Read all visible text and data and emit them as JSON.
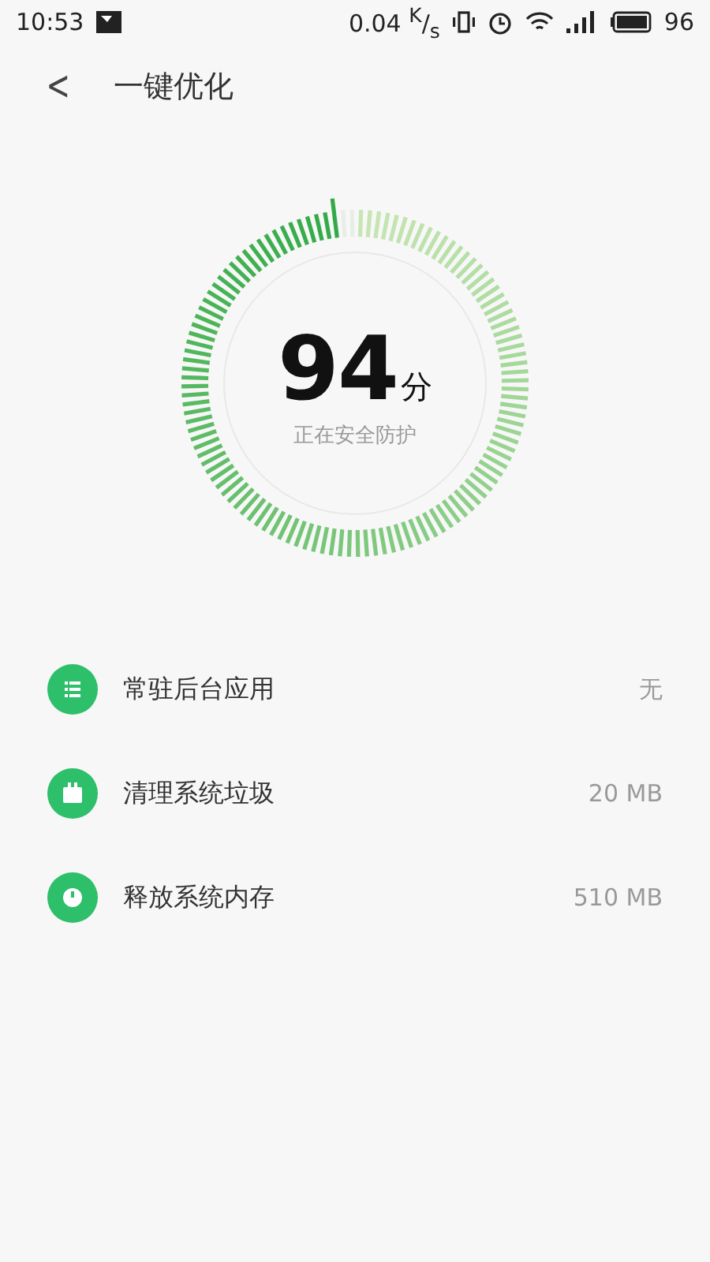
{
  "status_bar": {
    "time": "10:53",
    "net_speed": "0.04 $^{K}$/$_{s}$",
    "battery": "96"
  },
  "header": {
    "back": "<",
    "title": "一键优化"
  },
  "score": {
    "value": "94",
    "unit": "分",
    "status": "正在安全防护"
  },
  "items": [
    {
      "kind": "list",
      "label": "常驻后台应用",
      "value": "无"
    },
    {
      "kind": "trash",
      "label": "清理系统垃圾",
      "value": "20 MB"
    },
    {
      "kind": "memory",
      "label": "释放系统内存",
      "value": "510 MB"
    }
  ]
}
